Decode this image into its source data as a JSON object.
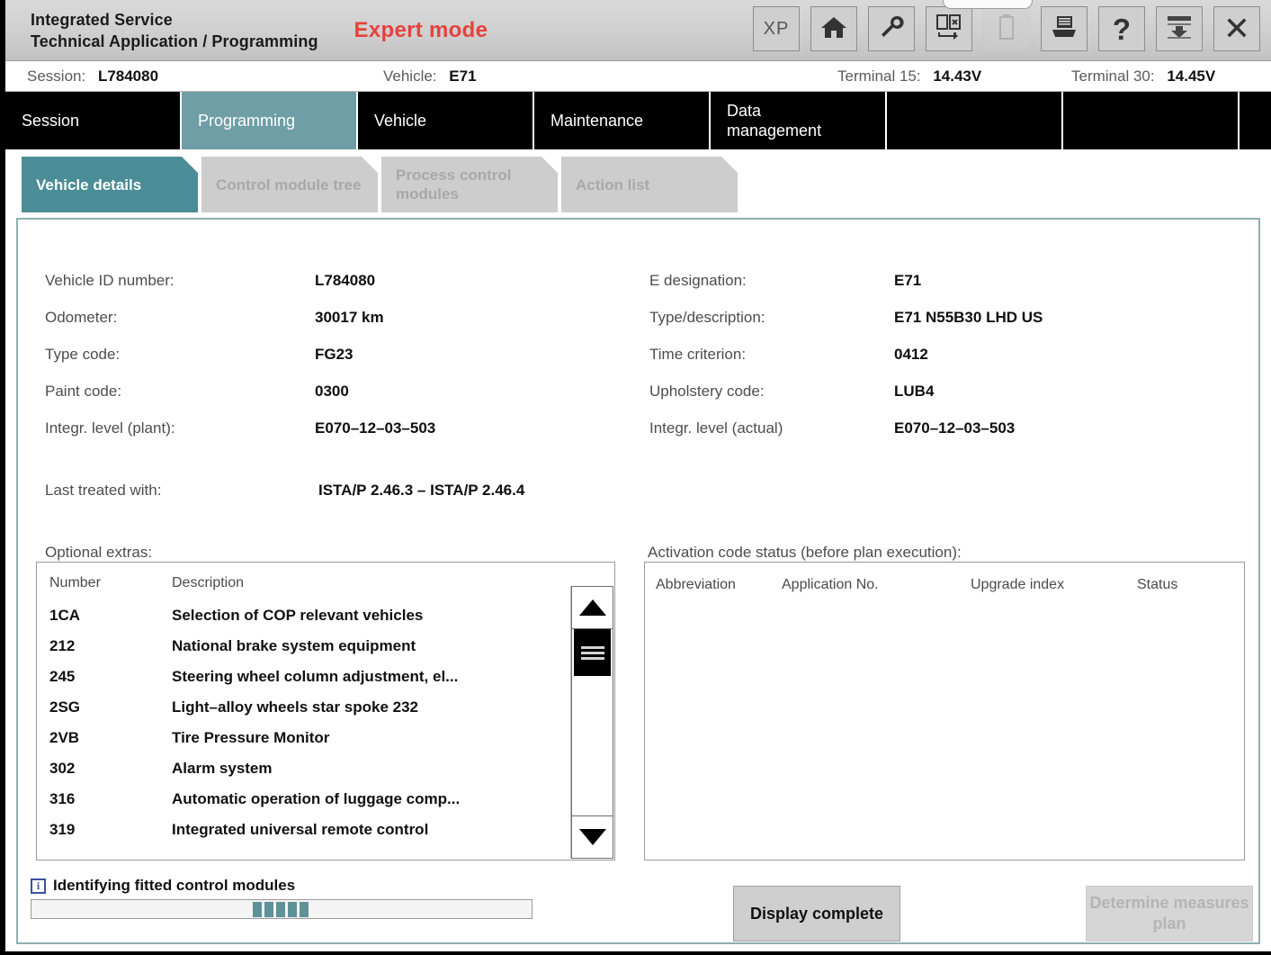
{
  "header": {
    "app_title_line1": "Integrated Service",
    "app_title_line2": "Technical Application / Programming",
    "mode_label": "Expert mode",
    "toolbar": [
      {
        "name": "xp-button",
        "label": "XP"
      },
      {
        "name": "home-icon",
        "label": ""
      },
      {
        "name": "wrench-icon",
        "label": ""
      },
      {
        "name": "compare-cards-icon",
        "label": ""
      },
      {
        "name": "battery-icon",
        "label": ""
      },
      {
        "name": "printer-icon",
        "label": ""
      },
      {
        "name": "help-icon",
        "label": "?"
      },
      {
        "name": "export-icon",
        "label": ""
      },
      {
        "name": "close-icon",
        "label": "✕"
      }
    ]
  },
  "session_bar": {
    "session_label": "Session:",
    "session_value": "L784080",
    "vehicle_label": "Vehicle:",
    "vehicle_value": "E71",
    "terminal15_label": "Terminal 15:",
    "terminal15_value": "14.43V",
    "terminal30_label": "Terminal 30:",
    "terminal30_value": "14.45V"
  },
  "main_tabs": [
    {
      "label": "Session",
      "active": false
    },
    {
      "label": "Programming",
      "active": true
    },
    {
      "label": "Vehicle",
      "active": false
    },
    {
      "label": "Maintenance",
      "active": false
    },
    {
      "label": "Data management",
      "active": false
    },
    {
      "label": "",
      "active": false
    },
    {
      "label": "",
      "active": false
    }
  ],
  "sub_tabs": [
    {
      "label": "Vehicle details",
      "active": true,
      "enabled": true
    },
    {
      "label": "Control module tree",
      "active": false,
      "enabled": false
    },
    {
      "label": "Process control modules",
      "active": false,
      "enabled": false
    },
    {
      "label": "Action list",
      "active": false,
      "enabled": false
    }
  ],
  "vehicle_details": {
    "left": [
      {
        "label": "Vehicle ID number:",
        "value": "L784080"
      },
      {
        "label": "Odometer:",
        "value": "30017 km"
      },
      {
        "label": "Type code:",
        "value": "FG23"
      },
      {
        "label": "Paint code:",
        "value": "0300"
      },
      {
        "label": "Integr. level (plant):",
        "value": "E070–12–03–503"
      }
    ],
    "right": [
      {
        "label": "E designation:",
        "value": "E71"
      },
      {
        "label": "Type/description:",
        "value": "E71 N55B30 LHD US"
      },
      {
        "label": "Time criterion:",
        "value": "0412"
      },
      {
        "label": "Upholstery code:",
        "value": "LUB4"
      },
      {
        "label": "Integr. level (actual)",
        "value": "E070–12–03–503"
      }
    ],
    "last_treated_label": "Last treated with:",
    "last_treated_value": "ISTA/P 2.46.3 – ISTA/P 2.46.4"
  },
  "optional_extras": {
    "title": "Optional extras:",
    "columns": [
      "Number",
      "Description"
    ],
    "rows": [
      {
        "number": "1CA",
        "description": "Selection of COP relevant vehicles"
      },
      {
        "number": "212",
        "description": "National brake system equipment"
      },
      {
        "number": "245",
        "description": "Steering wheel column adjustment, el..."
      },
      {
        "number": "2SG",
        "description": "Light–alloy wheels star spoke 232"
      },
      {
        "number": "2VB",
        "description": "Tire Pressure Monitor"
      },
      {
        "number": "302",
        "description": "Alarm system"
      },
      {
        "number": "316",
        "description": "Automatic operation of luggage comp..."
      },
      {
        "number": "319",
        "description": "Integrated universal remote control"
      }
    ]
  },
  "activation_status": {
    "title": "Activation code status (before plan execution):",
    "columns": [
      "Abbreviation",
      "Application No.",
      "Upgrade index",
      "Status"
    ],
    "rows": []
  },
  "footer": {
    "status_text": "Identifying fitted control modules",
    "info_icon_glyph": "i",
    "progress_segments": 5,
    "display_complete_label": "Display complete",
    "determine_plan_label": "Determine measures plan"
  },
  "colors": {
    "accent_teal": "#4b8d96",
    "tab_teal": "#6f9ea6",
    "expert_red": "#e8413c",
    "progress_teal": "#5e9298"
  }
}
